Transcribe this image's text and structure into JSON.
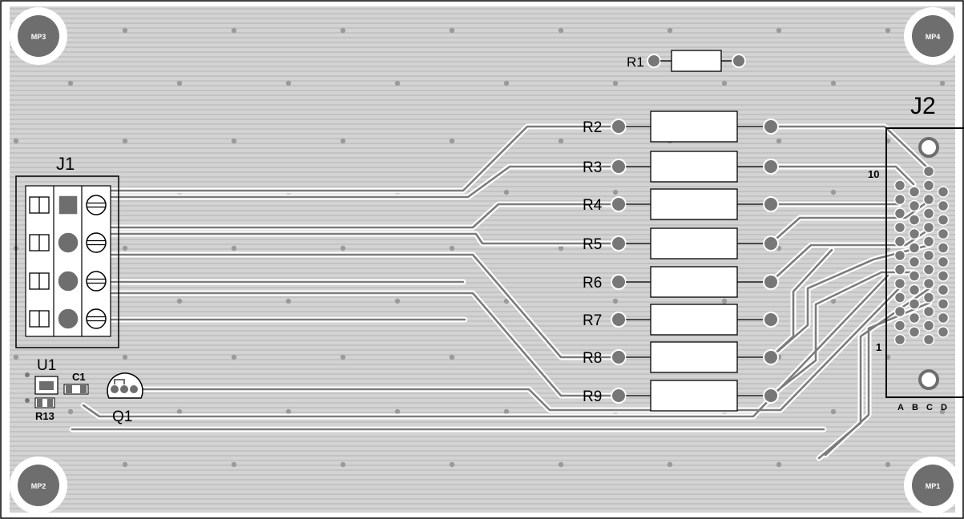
{
  "board": {
    "copper_color": "#cfcfcf",
    "hatch_color": "#bdbdbd",
    "pad_color": "#6e6e6e",
    "hole_color": "#7a7a7a",
    "outline_color": "#000000"
  },
  "mounting_holes": [
    "MP3",
    "MP4",
    "MP2",
    "MP1"
  ],
  "connectors": {
    "j1": "J1",
    "j2": "J2",
    "j2_pin_first": "10",
    "j2_pin_last": "1",
    "j2_columns": [
      "A",
      "B",
      "C",
      "D"
    ]
  },
  "resistors": [
    "R1",
    "R2",
    "R3",
    "R4",
    "R5",
    "R6",
    "R7",
    "R8",
    "R9"
  ],
  "components": {
    "u1": "U1",
    "c1": "C1",
    "r13": "R13",
    "q1": "Q1"
  }
}
